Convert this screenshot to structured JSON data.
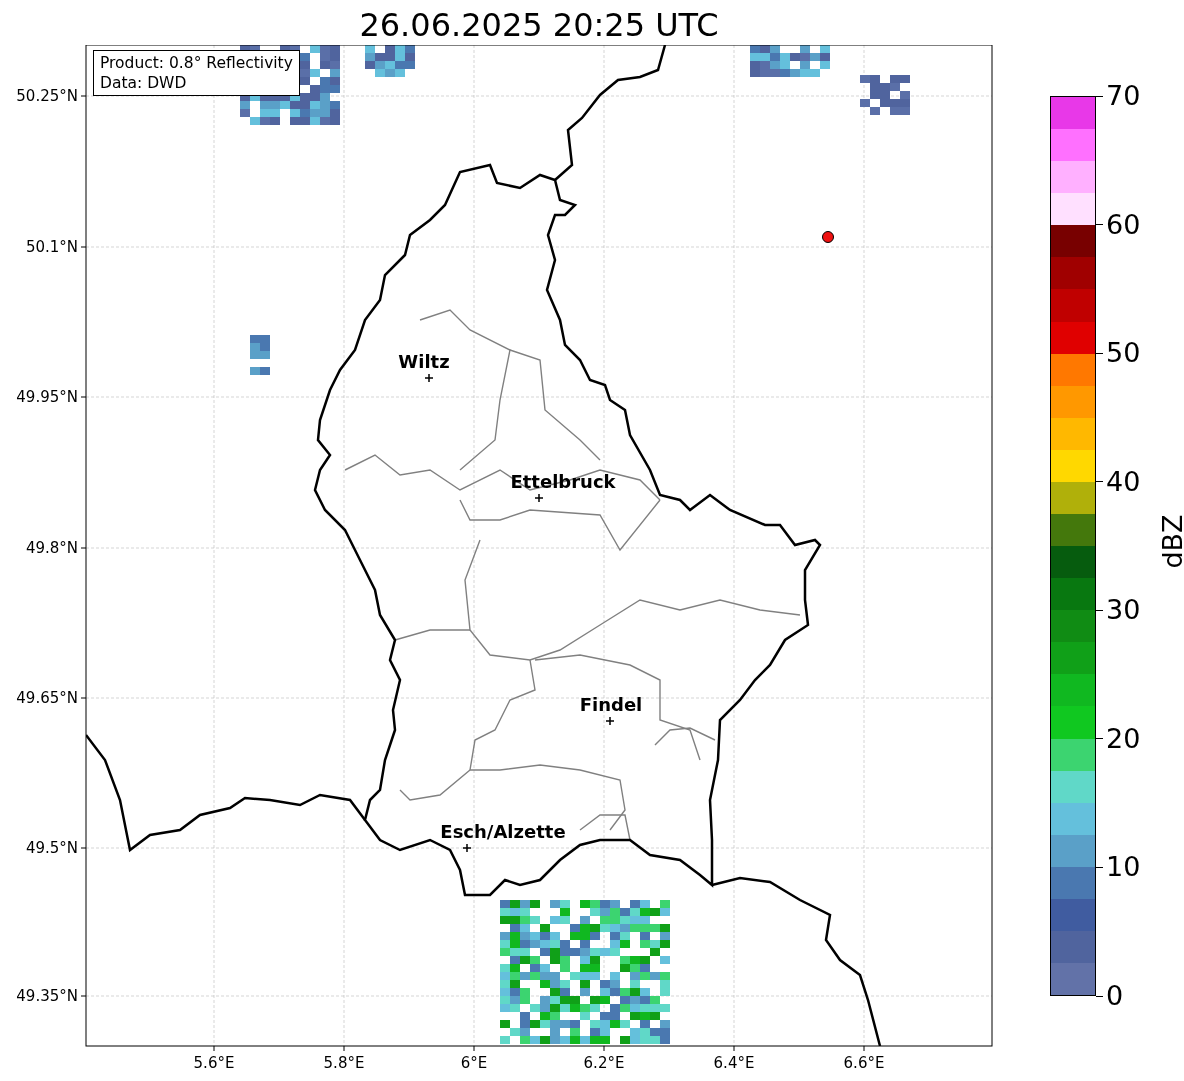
{
  "title": "26.06.2025 20:25 UTC",
  "info_box": {
    "lines": [
      "Product: 0.8° Reflectivity",
      "Data: DWD"
    ]
  },
  "axes": {
    "lat_ticks": [
      "50.25°N",
      "50.1°N",
      "49.95°N",
      "49.8°N",
      "49.65°N",
      "49.5°N",
      "49.35°N"
    ],
    "lon_ticks": [
      "5.6°E",
      "5.8°E",
      "6°E",
      "6.2°E",
      "6.4°E",
      "6.6°E"
    ]
  },
  "cities": [
    {
      "name": "Wiltz"
    },
    {
      "name": "Ettelbruck"
    },
    {
      "name": "Findel"
    },
    {
      "name": "Esch/Alzette"
    }
  ],
  "colorbar": {
    "label": "dBZ",
    "ticks": [
      "70",
      "60",
      "50",
      "40",
      "30",
      "20",
      "10",
      "0"
    ],
    "segments": [
      {
        "color": "#e838e8"
      },
      {
        "color": "#ff70ff"
      },
      {
        "color": "#ffb0ff"
      },
      {
        "color": "#ffe0ff"
      },
      {
        "color": "#780000"
      },
      {
        "color": "#a00000"
      },
      {
        "color": "#c00000"
      },
      {
        "color": "#e00000"
      },
      {
        "color": "#ff7800"
      },
      {
        "color": "#ff9800"
      },
      {
        "color": "#ffb800"
      },
      {
        "color": "#ffd800"
      },
      {
        "color": "#b0b00a"
      },
      {
        "color": "#44780c"
      },
      {
        "color": "#065c0e"
      },
      {
        "color": "#087810"
      },
      {
        "color": "#108c14"
      },
      {
        "color": "#10a018"
      },
      {
        "color": "#10b820"
      },
      {
        "color": "#10c820"
      },
      {
        "color": "#3cd470"
      },
      {
        "color": "#60d8c8"
      },
      {
        "color": "#64c0dc"
      },
      {
        "color": "#5aa0c8"
      },
      {
        "color": "#4a78b0"
      },
      {
        "color": "#405ca0"
      },
      {
        "color": "#50649e"
      },
      {
        "color": "#6272a8"
      }
    ]
  }
}
